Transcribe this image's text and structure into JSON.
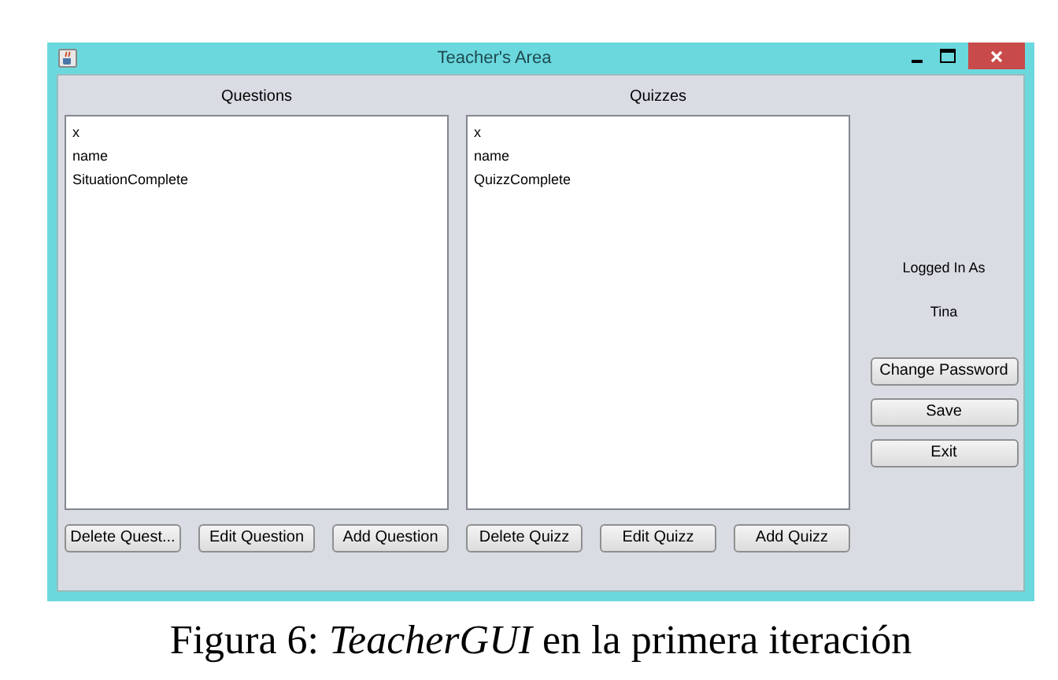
{
  "window": {
    "title": "Teacher's Area"
  },
  "panels": [
    {
      "heading": "Questions",
      "items": [
        "x",
        "name",
        "SituationComplete"
      ],
      "buttons": [
        "Delete Quest...",
        "Edit Question",
        "Add Question"
      ]
    },
    {
      "heading": "Quizzes",
      "items": [
        "x",
        "name",
        "QuizzComplete"
      ],
      "buttons": [
        "Delete Quizz",
        "Edit Quizz",
        "Add Quizz"
      ]
    }
  ],
  "sidebar": {
    "logged_in_label": "Logged In As",
    "user": "Tina",
    "buttons": [
      "Change Password",
      "Save",
      "Exit"
    ]
  },
  "caption": "Figura 6: *TeacherGUI* en la primera iteración"
}
